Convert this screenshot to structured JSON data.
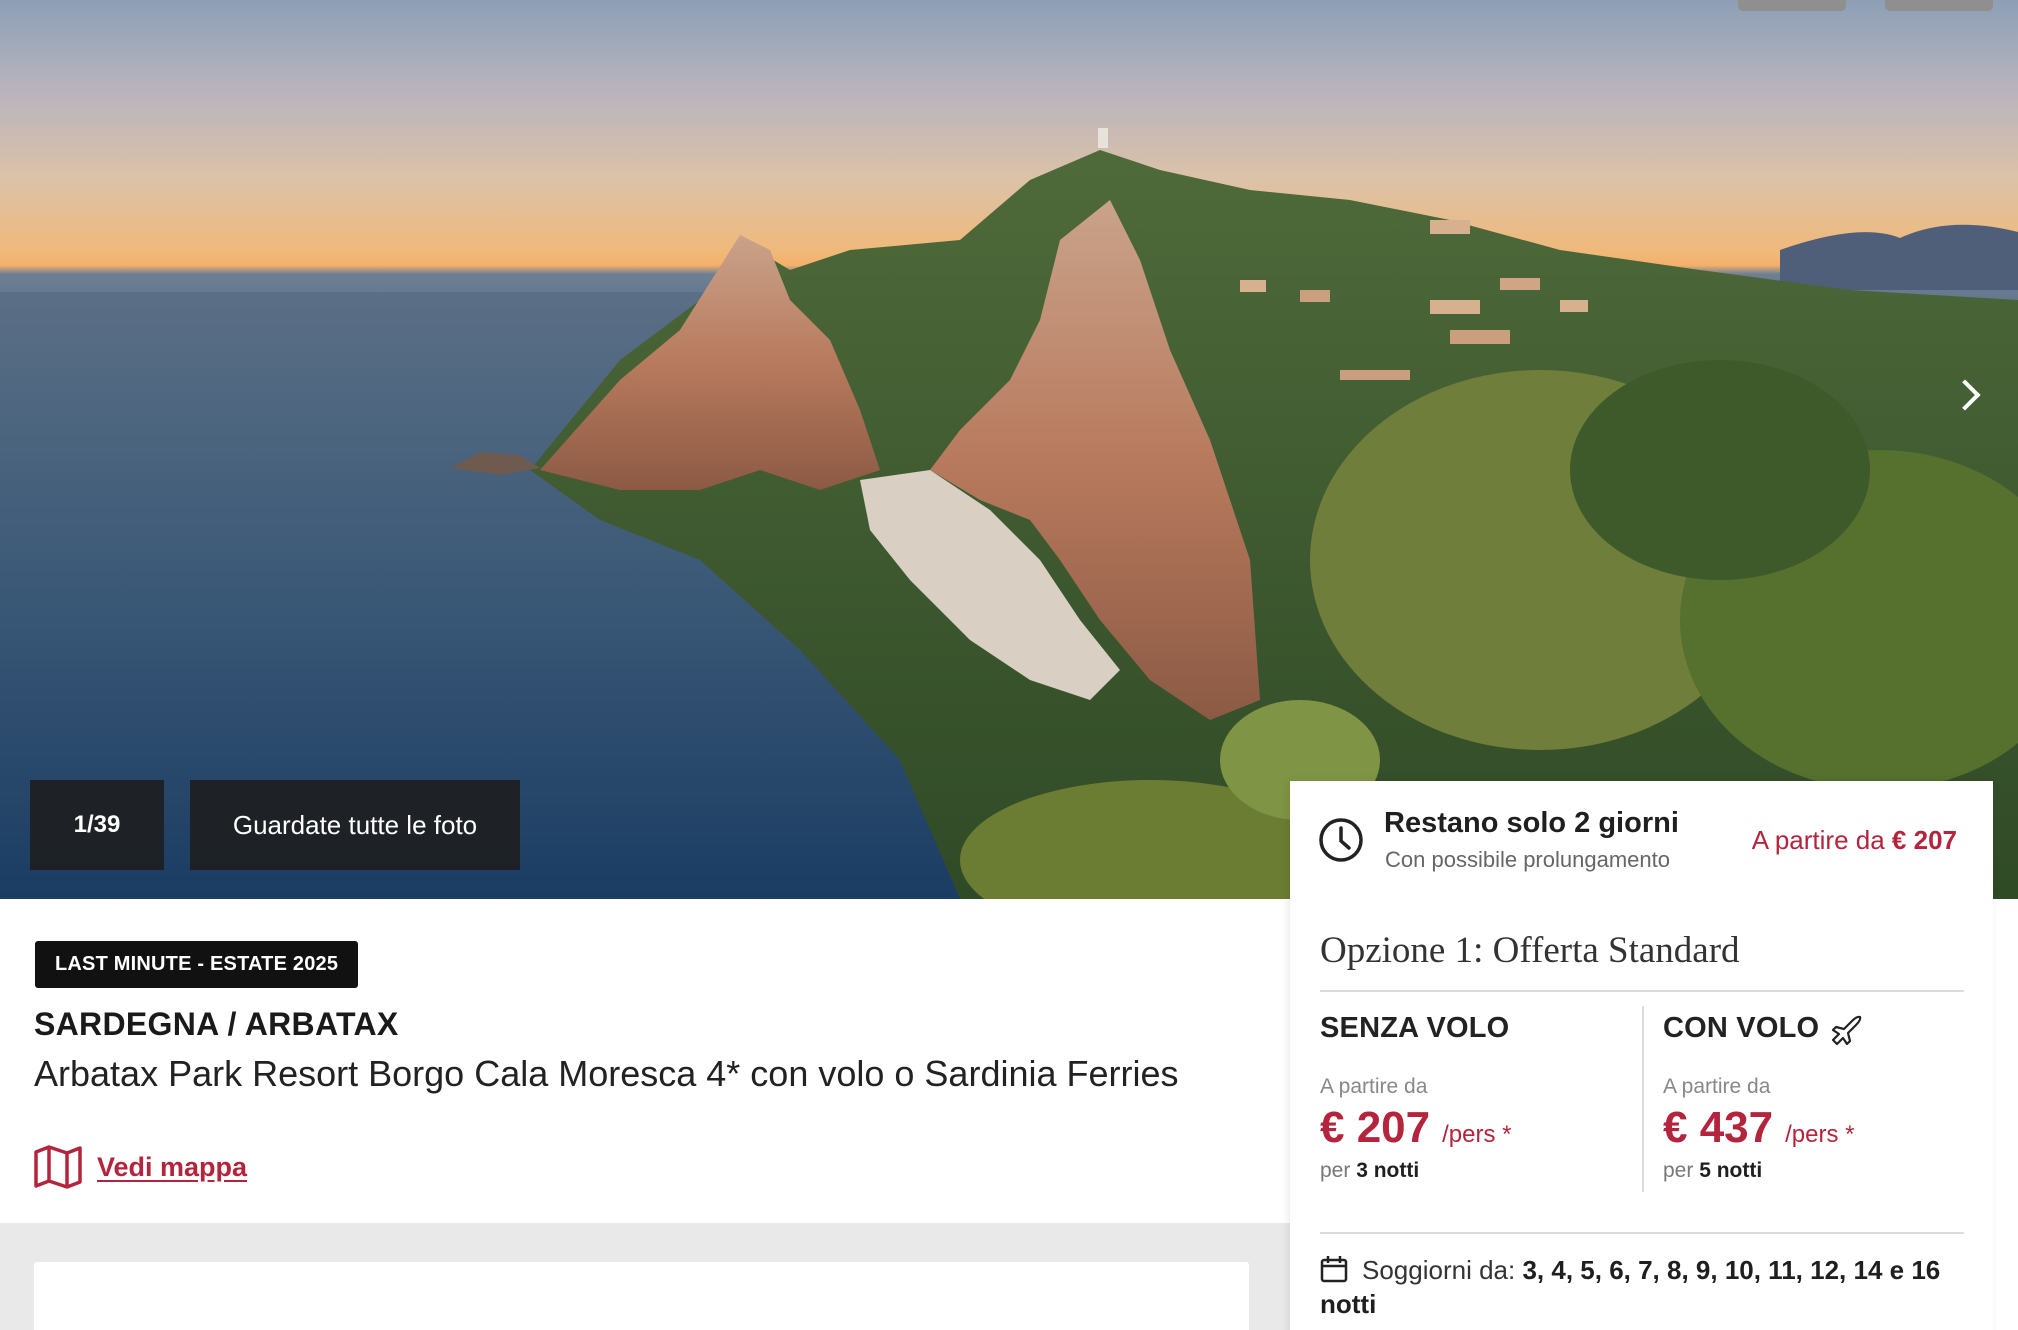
{
  "gallery": {
    "counter": "1/39",
    "view_all_label": "Guardate tutte le foto"
  },
  "offer": {
    "badge": "LAST MINUTE - ESTATE 2025",
    "location": "SARDEGNA / ARBATAX",
    "hotel_name": "Arbatax Park Resort Borgo Cala Moresca 4* con volo o Sardinia Ferries",
    "map_link": "Vedi mappa"
  },
  "booking": {
    "timer_title": "Restano solo 2 giorni",
    "timer_subtitle": "Con possibile prolungamento",
    "from_label": "A partire da",
    "from_price": "€ 207",
    "option_title": "Opzione 1: Offerta Standard",
    "without_flight": {
      "title": "SENZA VOLO",
      "from_label": "A partire da",
      "price": "€ 207",
      "unit": "/pers *",
      "per_label": "per",
      "nights": "3 notti"
    },
    "with_flight": {
      "title": "CON VOLO",
      "from_label": "A partire da",
      "price": "€ 437",
      "unit": "/pers *",
      "per_label": "per",
      "nights": "5 notti"
    },
    "stays_label": "Soggiorni da:",
    "stays_values": "3, 4, 5, 6, 7, 8, 9, 10, 11, 12, 14 e 16 notti"
  },
  "icons": {
    "next_arrow": "chevron-right-icon",
    "map": "map-icon",
    "timer": "clock-icon",
    "flight": "airplane-icon",
    "calendar": "calendar-icon"
  },
  "colors": {
    "accent": "#b5243d",
    "badge_bg": "#111111",
    "text_dark": "#1f1f1f",
    "band_grey": "#e9e9e9"
  }
}
